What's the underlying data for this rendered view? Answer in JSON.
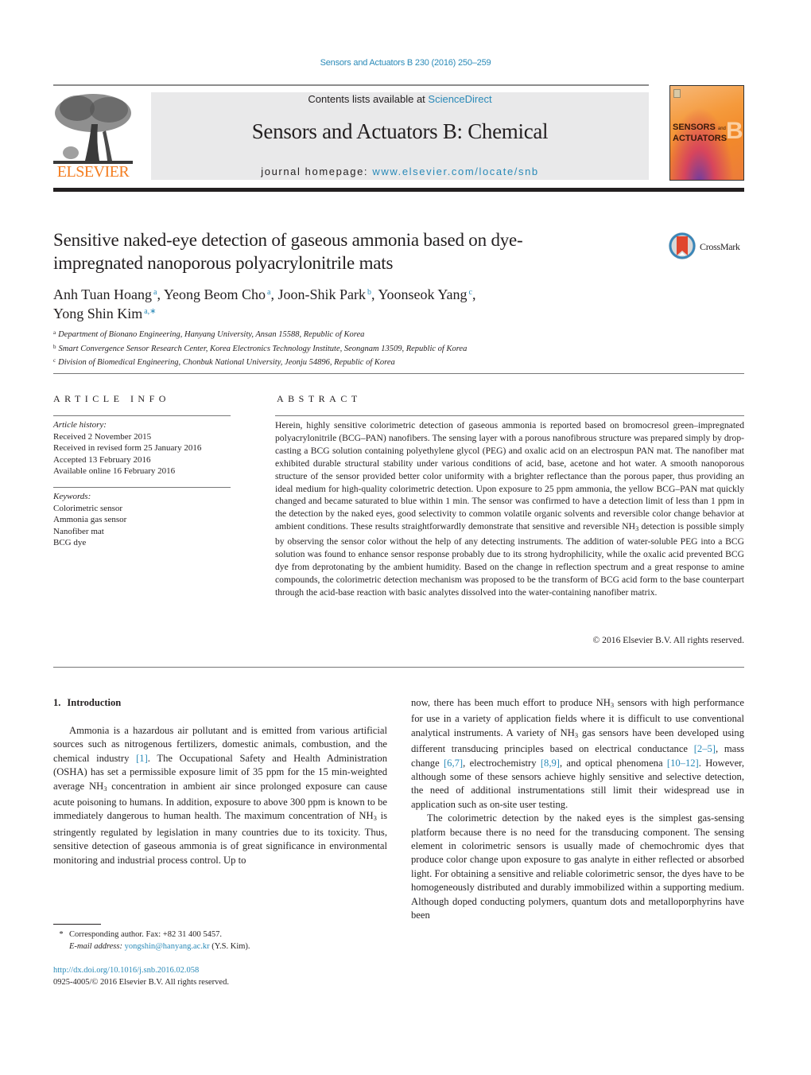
{
  "header": {
    "citation": "Sensors and Actuators B 230 (2016) 250–259",
    "publisher_logo_text": "ELSEVIER",
    "contents_prefix": "Contents lists available at ",
    "contents_link": "ScienceDirect",
    "journal_title": "Sensors and Actuators B: Chemical",
    "homepage_prefix": "journal homepage: ",
    "homepage_link": "www.elsevier.com/locate/snb",
    "cover": {
      "line1": "SENSORS",
      "line1_small": "and",
      "line2": "ACTUATORS",
      "letter": "B"
    },
    "colors": {
      "link": "#2a8ab8",
      "elsevier_orange": "#f47d20",
      "masthead_bg": "#e9e9ea"
    }
  },
  "article": {
    "title": "Sensitive naked-eye detection of gaseous ammonia based on dye-impregnated nanoporous polyacrylonitrile mats",
    "crossmark_label": "CrossMark",
    "authors": [
      {
        "name": "Anh Tuan Hoang",
        "sup": "a",
        "sep": ", "
      },
      {
        "name": "Yeong Beom Cho",
        "sup": "a",
        "sep": ", "
      },
      {
        "name": "Joon-Shik Park",
        "sup": "b",
        "sep": ", "
      },
      {
        "name": "Yoonseok Yang",
        "sup": "c",
        "sep": ","
      },
      {
        "name": "Yong Shin Kim",
        "sup": "a,∗",
        "sep": ""
      }
    ],
    "affiliations": [
      {
        "key": "a",
        "text": "Department of Bionano Engineering, Hanyang University, Ansan 15588, Republic of Korea"
      },
      {
        "key": "b",
        "text": "Smart Convergence Sensor Research Center, Korea Electronics Technology Institute, Seongnam 13509, Republic of Korea"
      },
      {
        "key": "c",
        "text": "Division of Biomedical Engineering, Chonbuk National University, Jeonju 54896, Republic of Korea"
      }
    ]
  },
  "article_info": {
    "heading": "ARTICLE INFO",
    "history_label": "Article history:",
    "history": [
      "Received 2 November 2015",
      "Received in revised form 25 January 2016",
      "Accepted 13 February 2016",
      "Available online 16 February 2016"
    ],
    "keywords_label": "Keywords:",
    "keywords": [
      "Colorimetric sensor",
      "Ammonia gas sensor",
      "Nanofiber mat",
      "BCG dye"
    ]
  },
  "abstract": {
    "heading": "ABSTRACT",
    "text_part1": "Herein, highly sensitive colorimetric detection of gaseous ammonia is reported based on bromocresol green–impregnated polyacrylonitrile (BCG–PAN) nanofibers. The sensing layer with a porous nanofibrous structure was prepared simply by drop-casting a BCG solution containing polyethylene glycol (PEG) and oxalic acid on an electrospun PAN mat. The nanofiber mat exhibited durable structural stability under various conditions of acid, base, acetone and hot water. A smooth nanoporous structure of the sensor provided better color uniformity with a brighter reflectance than the porous paper, thus providing an ideal medium for high-quality colorimetric detection. Upon exposure to 25 ppm ammonia, the yellow BCG–PAN mat quickly changed and became saturated to blue within 1 min. The sensor was confirmed to have a detection limit of less than 1 ppm in the detection by the naked eyes, good selectivity to common volatile organic solvents and reversible color change behavior at ambient conditions. These results straightforwardly demonstrate that sensitive and reversible NH",
    "text_sub": "3",
    "text_part2": " detection is possible simply by observing the sensor color without the help of any detecting instruments. The addition of water-soluble PEG into a BCG solution was found to enhance sensor response probably due to its strong hydrophilicity, while the oxalic acid prevented BCG dye from deprotonating by the ambient humidity. Based on the change in reflection spectrum and a great response to amine compounds, the colorimetric detection mechanism was proposed to be the transform of BCG acid form to the base counterpart through the acid-base reaction with basic analytes dissolved into the water-containing nanofiber matrix.",
    "copyright": "© 2016 Elsevier B.V. All rights reserved."
  },
  "introduction": {
    "section_number": "1.",
    "heading": "Introduction",
    "left": {
      "p1_a": "Ammonia is a hazardous air pollutant and is emitted from various artificial sources such as nitrogenous fertilizers, domestic animals, combustion, and the chemical industry ",
      "p1_ref1": "[1]",
      "p1_b": ". The Occupational Safety and Health Administration (OSHA) has set a permissible exposure limit of 35 ppm for the 15 min-weighted average NH",
      "p1_c": " concentration in ambient air since prolonged exposure can cause acute poisoning to humans. In addition, exposure to above 300 ppm is known to be immediately dangerous to human health. The maximum concentration of NH",
      "p1_d": " is stringently regulated by legislation in many countries due to its toxicity. Thus, sensitive detection of gaseous ammonia is of great significance in environmental monitoring and industrial process control. Up to",
      "sub": "3"
    },
    "right": {
      "p1_a": "now, there has been much effort to produce NH",
      "p1_b": " sensors with high performance for use in a variety of application fields where it is difficult to use conventional analytical instruments. A variety of NH",
      "p1_c": " gas sensors have been developed using different transducing principles based on electrical conductance ",
      "ref_2_5": "[2–5]",
      "p1_d": ", mass change ",
      "ref_6_7": "[6,7]",
      "p1_e": ", electrochemistry ",
      "ref_8_9": "[8,9]",
      "p1_f": ", and optical phenomena ",
      "ref_10_12": "[10–12]",
      "p1_g": ". However, although some of these sensors achieve highly sensitive and selective detection, the need of additional instrumentations still limit their widespread use in application such as on-site user testing.",
      "p2": "The colorimetric detection by the naked eyes is the simplest gas-sensing platform because there is no need for the transducing component. The sensing element in colorimetric sensors is usually made of chemochromic dyes that produce color change upon exposure to gas analyte in either reflected or absorbed light. For obtaining a sensitive and reliable colorimetric sensor, the dyes have to be homogeneously distributed and durably immobilized within a supporting medium. Although doped conducting polymers, quantum dots and metalloporphyrins have been",
      "sub": "3"
    }
  },
  "footer": {
    "star": "*",
    "corresponding": "Corresponding author. Fax: +82 31 400 5457.",
    "email_label": "E-mail address:",
    "email": "yongshin@hanyang.ac.kr",
    "email_suffix": " (Y.S. Kim).",
    "doi": "http://dx.doi.org/10.1016/j.snb.2016.02.058",
    "issn_copyright": "0925-4005/© 2016 Elsevier B.V. All rights reserved."
  }
}
